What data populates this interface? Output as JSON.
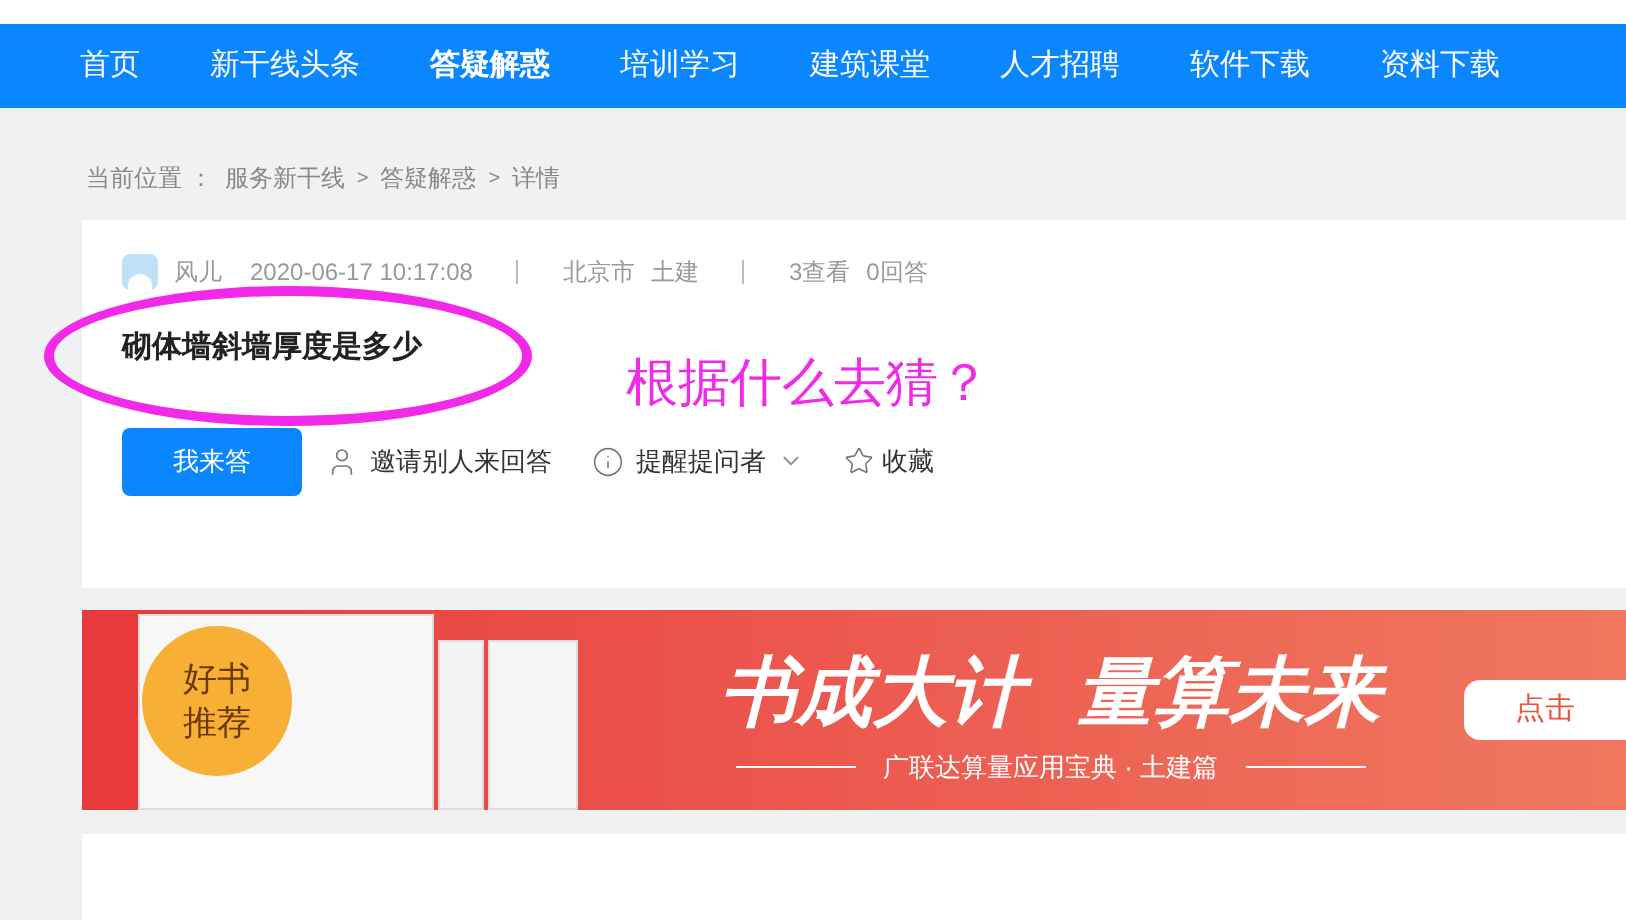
{
  "nav": [
    {
      "label": "首页",
      "selected": false
    },
    {
      "label": "新干线头条",
      "selected": false
    },
    {
      "label": "答疑解惑",
      "selected": true
    },
    {
      "label": "培训学习",
      "selected": false
    },
    {
      "label": "建筑课堂",
      "selected": false
    },
    {
      "label": "人才招聘",
      "selected": false
    },
    {
      "label": "软件下载",
      "selected": false
    },
    {
      "label": "资料下载",
      "selected": false
    }
  ],
  "breadcrumb": {
    "label": "当前位置 ：",
    "items": [
      "服务新干线",
      "答疑解惑",
      "详情"
    ],
    "separator": ">"
  },
  "question": {
    "author": "风儿",
    "time": "2020-06-17 10:17:08",
    "location": "北京市",
    "category": "土建",
    "views": "3查看",
    "answers": "0回答",
    "title": "砌体墙斜墙厚度是多少",
    "actions": {
      "answer": "我来答",
      "invite": "邀请别人来回答",
      "remind": "提醒提问者",
      "favorite": "收藏"
    }
  },
  "annotation": {
    "text": "根据什么去猜？"
  },
  "banner": {
    "badge": "好书推荐",
    "headline": "书成大计  量算未来",
    "subtitle": "广联达算量应用宝典 · 土建篇",
    "button": "点击"
  }
}
